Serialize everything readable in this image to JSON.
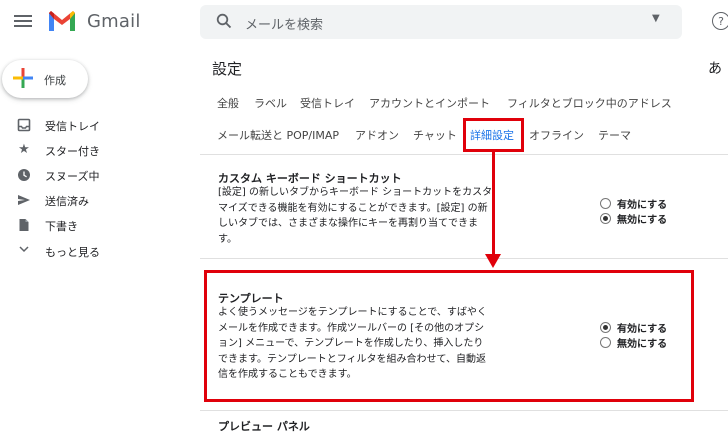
{
  "header": {
    "logo_text": "Gmail",
    "search_placeholder": "メールを検索"
  },
  "sidebar": {
    "compose_label": "作成",
    "items": [
      {
        "label": "受信トレイ",
        "icon": "inbox-icon"
      },
      {
        "label": "スター付き",
        "icon": "star-icon"
      },
      {
        "label": "スヌーズ中",
        "icon": "clock-icon"
      },
      {
        "label": "送信済み",
        "icon": "send-icon"
      },
      {
        "label": "下書き",
        "icon": "draft-icon"
      },
      {
        "label": "もっと見る",
        "icon": "chevron-down-icon"
      }
    ]
  },
  "main": {
    "title": "設定",
    "account_char": "あ",
    "tabs_row1": [
      "全般",
      "ラベル",
      "受信トレイ",
      "アカウントとインポート",
      "フィルタとブロック中のアドレス"
    ],
    "tabs_row2": [
      "メール転送と POP/IMAP",
      "アドオン",
      "チャット",
      "詳細設定",
      "オフライン",
      "テーマ"
    ],
    "active_tab": "詳細設定",
    "sections": [
      {
        "title": "カスタム キーボード ショートカット",
        "desc_lines": [
          "[設定] の新しいタブからキーボード ショートカットをカスタ",
          "マイズできる機能を有効にすることができます。[設定] の新",
          "しいタブでは、さまざまな操作にキーを再割り当てできま",
          "す。"
        ],
        "options": [
          "有効にする",
          "無効にする"
        ],
        "selected": 1
      },
      {
        "title": "テンプレート",
        "desc_lines": [
          "よく使うメッセージをテンプレートにすることで、すばやく",
          "メールを作成できます。作成ツールバーの [その他のオプシ",
          "ョン] メニューで、テンプレートを作成したり、挿入したり",
          "できます。テンプレートとフィルタを組み合わせて、自動返",
          "信を作成することもできます。"
        ],
        "options": [
          "有効にする",
          "無効にする"
        ],
        "selected": 0
      }
    ],
    "next_section_title": "プレビュー パネル"
  },
  "colors": {
    "highlight": "#e0000a",
    "link_blue": "#1a73e8",
    "gmail_red": "#ea4335"
  }
}
